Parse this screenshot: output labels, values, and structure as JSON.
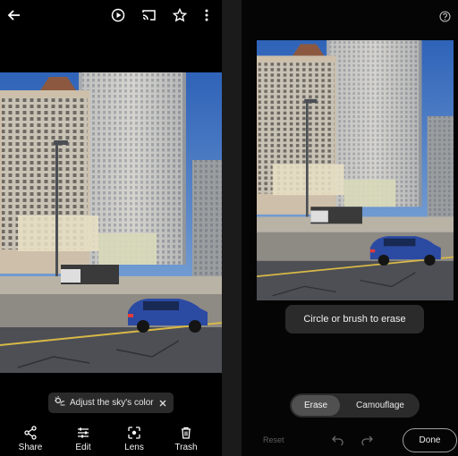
{
  "left_panel": {
    "top_bar": {
      "icons": [
        "back-arrow-icon",
        "motion-play-icon",
        "cast-icon",
        "star-icon",
        "more-vert-icon"
      ]
    },
    "suggestion_chip": {
      "text": "Adjust the sky's color",
      "icon": "sky-adjust-icon",
      "close_icon": "close-icon"
    },
    "actions": [
      {
        "label": "Share",
        "icon": "share-icon"
      },
      {
        "label": "Edit",
        "icon": "sliders-icon"
      },
      {
        "label": "Lens",
        "icon": "lens-icon"
      },
      {
        "label": "Trash",
        "icon": "trash-icon"
      }
    ]
  },
  "right_panel": {
    "help_icon": "help-icon",
    "toast": "Circle or brush to erase",
    "modes": [
      {
        "label": "Erase",
        "selected": true
      },
      {
        "label": "Camouflage",
        "selected": false
      }
    ],
    "reset_label": "Reset",
    "undo_icon": "undo-icon",
    "redo_icon": "redo-icon",
    "done_label": "Done"
  }
}
